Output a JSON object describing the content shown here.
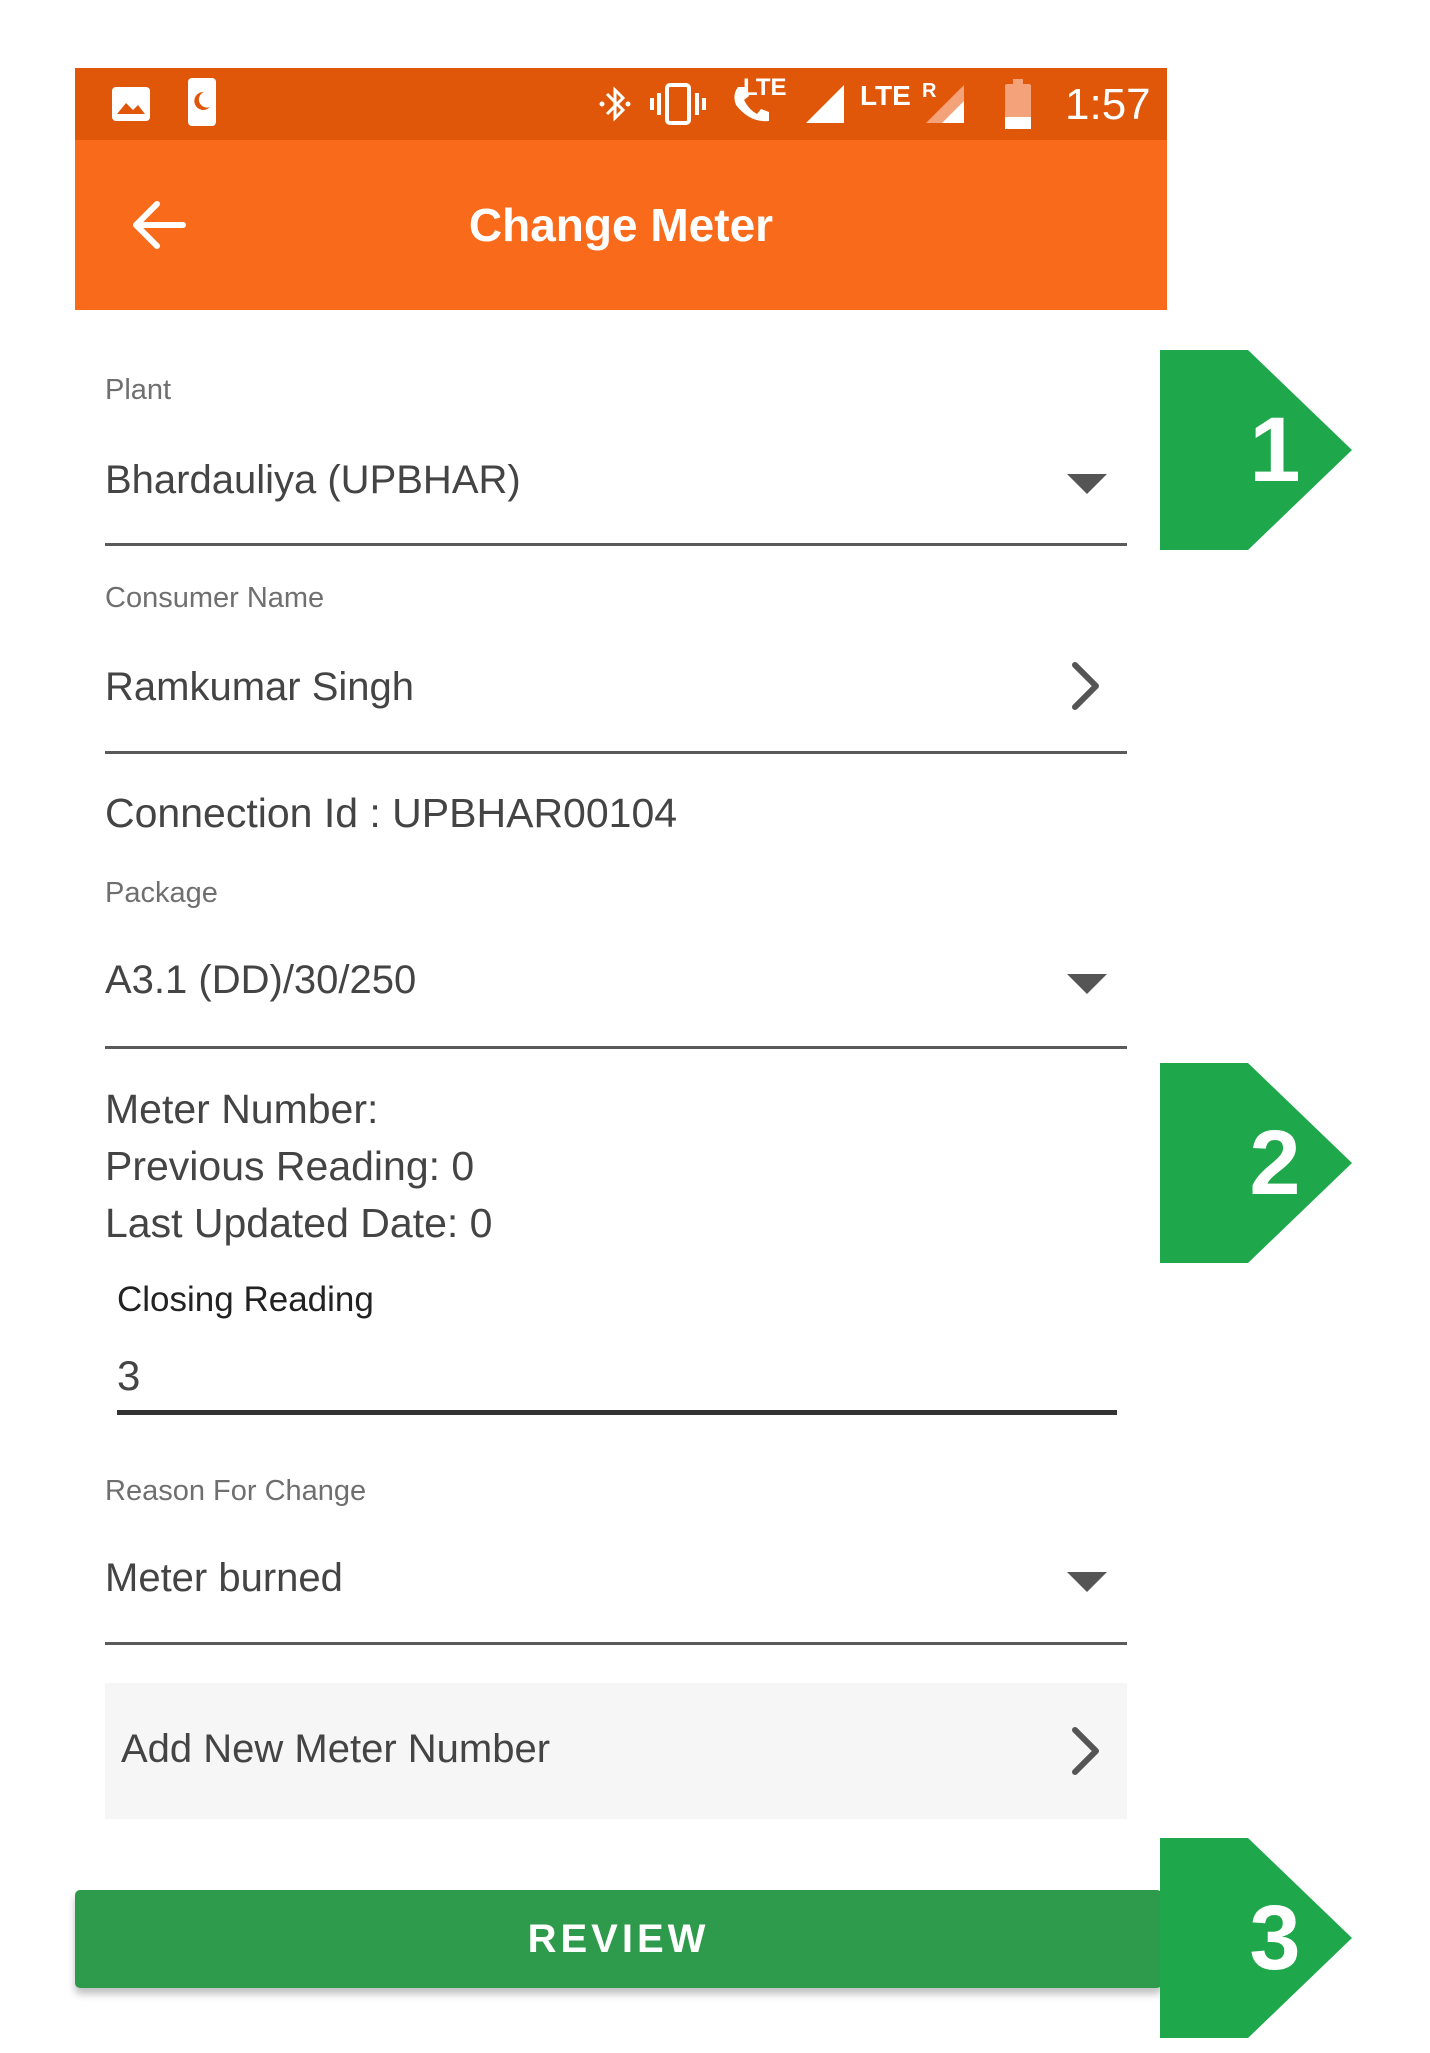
{
  "status_bar": {
    "time": "1:57",
    "lte_label_1": "LTE",
    "lte_label_2": "LTE",
    "roaming_label": "R"
  },
  "app_bar": {
    "title": "Change Meter"
  },
  "form": {
    "plant": {
      "label": "Plant",
      "value": "Bhardauliya (UPBHAR)"
    },
    "consumer": {
      "label": "Consumer Name",
      "value": "Ramkumar Singh"
    },
    "connection_id": "Connection Id : UPBHAR00104",
    "package": {
      "label": "Package",
      "value": "A3.1 (DD)/30/250"
    },
    "meter_info": {
      "meter_number": "Meter Number:",
      "previous_reading": "Previous Reading: 0",
      "last_updated": "Last Updated Date: 0"
    },
    "closing_reading": {
      "label": "Closing Reading",
      "value": "3"
    },
    "reason": {
      "label": "Reason For Change",
      "value": "Meter burned"
    },
    "add_meter": {
      "label": "Add New Meter Number"
    },
    "review_button": "REVIEW"
  },
  "annotations": [
    {
      "number": "1",
      "color": "#1fa84b"
    },
    {
      "number": "2",
      "color": "#1fa84b"
    },
    {
      "number": "3",
      "color": "#1fa84b"
    }
  ],
  "colors": {
    "status_bar": "#e0570a",
    "app_bar": "#f96b1a",
    "review_button": "#2e9a4b",
    "badge": "#1fa84b"
  },
  "icons": {
    "status_left": [
      "image-icon",
      "phone-sleep-icon"
    ],
    "status_right": [
      "bluetooth-icon",
      "vibrate-icon",
      "volte-call-icon",
      "signal-icon",
      "signal-roaming-icon",
      "battery-icon"
    ],
    "app_bar": "back-arrow-icon",
    "dropdown": "caret-down-icon",
    "navigate": "chevron-right-icon"
  }
}
